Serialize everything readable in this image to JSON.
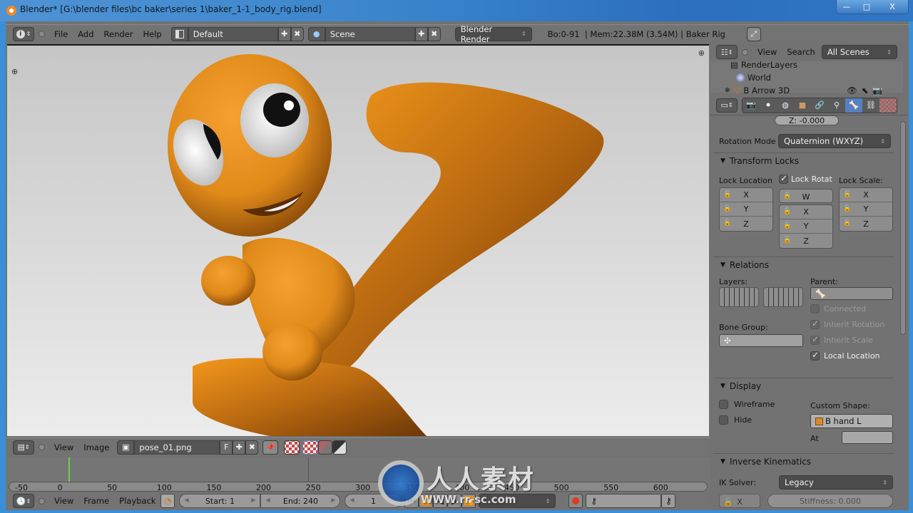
{
  "window": {
    "title": "Blender* [G:\\blender files\\bc baker\\series 1\\baker_1-1_body_rig.blend]",
    "controls": {
      "minimize": "—",
      "maximize": "□",
      "close": "X"
    }
  },
  "info_header": {
    "menus": [
      "File",
      "Add",
      "Render",
      "Help"
    ],
    "layout": "Default",
    "scene": "Scene",
    "render_engine": "Blender Render",
    "stats": "Bo:0-91  | Mem:22.38M (3.54M) | Baker Rig"
  },
  "outliner": {
    "menus": [
      "View",
      "Search"
    ],
    "display_mode": "All Scenes",
    "items": [
      {
        "label": "RenderLayers",
        "icon": "render-layers-icon"
      },
      {
        "label": "World",
        "icon": "world-icon"
      },
      {
        "label": "B Arrow 3D",
        "icon": "armature-icon"
      }
    ]
  },
  "properties": {
    "tabs": [
      "render",
      "render-layers",
      "scene",
      "world",
      "object",
      "constraints",
      "object-data",
      "bone",
      "bone-constraints",
      "texture"
    ],
    "active_tab": "bone",
    "z_value": "Z: -0.000",
    "rotation_mode_label": "Rotation Mode",
    "rotation_mode": "Quaternion (WXYZ)",
    "transform_locks": {
      "title": "Transform Locks",
      "lock_location_label": "Lock Location",
      "lock_rotation_label": "Lock Rotat",
      "lock_rotation_checked": true,
      "lock_scale_label": "Lock Scale:",
      "location_axes": [
        "X",
        "Y",
        "Z"
      ],
      "rotation_axes": [
        "W",
        "X",
        "Y",
        "Z"
      ],
      "scale_axes": [
        "X",
        "Y",
        "Z"
      ]
    },
    "relations": {
      "title": "Relations",
      "layers_label": "Layers:",
      "parent_label": "Parent:",
      "parent_value": "",
      "bone_group_label": "Bone Group:",
      "bone_group_value": "",
      "connected": {
        "label": "Connected",
        "checked": false,
        "enabled": false
      },
      "inherit_rotation": {
        "label": "Inherit Rotation",
        "checked": true,
        "enabled": false
      },
      "inherit_scale": {
        "label": "Inherit Scale",
        "checked": true,
        "enabled": false
      },
      "local_location": {
        "label": "Local Location",
        "checked": true,
        "enabled": true
      }
    },
    "display": {
      "title": "Display",
      "wireframe": {
        "label": "Wireframe",
        "checked": false
      },
      "hide": {
        "label": "Hide",
        "checked": false
      },
      "custom_shape_label": "Custom Shape:",
      "custom_shape_value": "B hand L",
      "at_label": "At",
      "at_value": ""
    },
    "inverse_kinematics": {
      "title": "Inverse Kinematics",
      "ik_solver_label": "IK Solver:",
      "ik_solver": "Legacy",
      "lock_axis": "X",
      "stiffness": "Stiffness: 0.000"
    }
  },
  "image_editor_header": {
    "menus": [
      "View",
      "Image"
    ],
    "image_name": "pose_01.png",
    "fake_user": "F"
  },
  "timeline": {
    "ruler_ticks": [
      "-50",
      "0",
      "50",
      "100",
      "150",
      "200",
      "250",
      "300",
      "350",
      "400",
      "450",
      "500",
      "550",
      "600"
    ],
    "current_frame_marker": "0",
    "menus": [
      "View",
      "Frame",
      "Playback"
    ],
    "start": "Start: 1",
    "end": "End: 240",
    "current_frame": "1",
    "keying_set": ""
  },
  "watermark": {
    "text_cn": "人人素材",
    "url": "WWW.rr-sc.com"
  },
  "colors": {
    "accent_blue": "#5680c2",
    "render_orange": "#f0901e",
    "viewport_bg": "#d6d6d6",
    "panel_bg": "#727272"
  }
}
